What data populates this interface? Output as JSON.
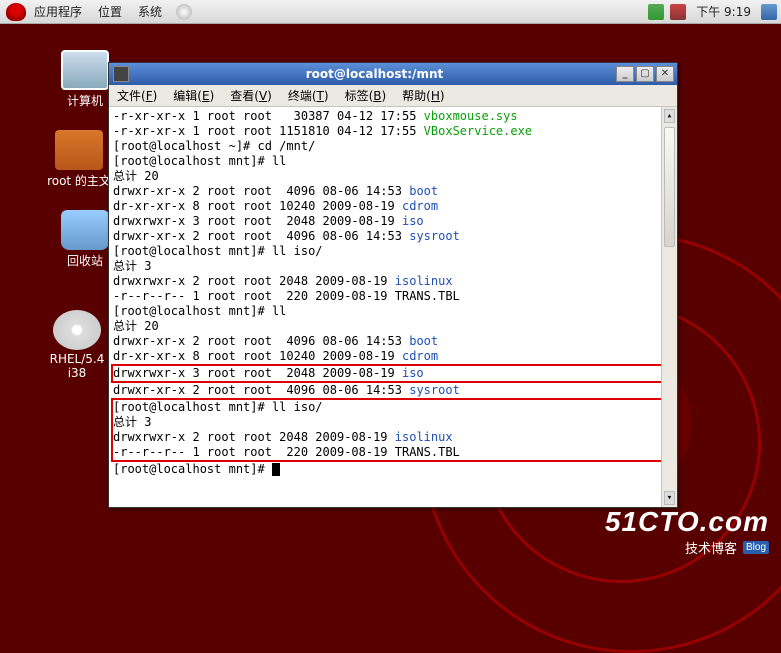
{
  "panel": {
    "menus": [
      "应用程序",
      "位置",
      "系统"
    ],
    "clock": "下午 9:19"
  },
  "desktop": {
    "computer": "计算机",
    "home": "root 的主文",
    "trash": "回收站",
    "disc": "RHEL/5.4 i38"
  },
  "terminal": {
    "title": "root@localhost:/mnt",
    "menubar": [
      {
        "label": "文件",
        "key": "F"
      },
      {
        "label": "编辑",
        "key": "E"
      },
      {
        "label": "查看",
        "key": "V"
      },
      {
        "label": "终端",
        "key": "T"
      },
      {
        "label": "标签",
        "key": "B"
      },
      {
        "label": "帮助",
        "key": "H"
      }
    ],
    "lines": [
      {
        "pre": "-r-xr-xr-x 1 root root   30387 04-12 17:55 ",
        "link": "vboxmouse.sys",
        "cls": "green"
      },
      {
        "pre": "-r-xr-xr-x 1 root root 1151810 04-12 17:55 ",
        "link": "VBoxService.exe",
        "cls": "green"
      },
      {
        "pre": "[root@localhost ~]# cd /mnt/"
      },
      {
        "pre": "[root@localhost mnt]# ll"
      },
      {
        "pre": "总计 20"
      },
      {
        "pre": "drwxr-xr-x 2 root root  4096 08-06 14:53 ",
        "link": "boot",
        "cls": "blue"
      },
      {
        "pre": "dr-xr-xr-x 8 root root 10240 2009-08-19 ",
        "link": "cdrom",
        "cls": "blue"
      },
      {
        "pre": "drwxrwxr-x 3 root root  2048 2009-08-19 ",
        "link": "iso",
        "cls": "blue"
      },
      {
        "pre": "drwxr-xr-x 2 root root  4096 08-06 14:53 ",
        "link": "sysroot",
        "cls": "blue"
      },
      {
        "pre": "[root@localhost mnt]# ll iso/"
      },
      {
        "pre": "总计 3"
      },
      {
        "pre": "drwxrwxr-x 2 root root 2048 2009-08-19 ",
        "link": "isolinux",
        "cls": "blue"
      },
      {
        "pre": "-r--r--r-- 1 root root  220 2009-08-19 TRANS.TBL"
      },
      {
        "pre": "[root@localhost mnt]# ll"
      },
      {
        "pre": "总计 20"
      },
      {
        "pre": "drwxr-xr-x 2 root root  4096 08-06 14:53 ",
        "link": "boot",
        "cls": "blue"
      },
      {
        "pre": "dr-xr-xr-x 8 root root 10240 2009-08-19 ",
        "link": "cdrom",
        "cls": "blue"
      }
    ],
    "boxed1": {
      "pre": "drwxrwxr-x 3 root root  2048 2009-08-19 ",
      "link": "iso",
      "cls": "blue"
    },
    "after_box1": [
      {
        "pre": "drwxr-xr-x 2 root root  4096 08-06 14:53 ",
        "link": "sysroot",
        "cls": "blue"
      }
    ],
    "boxed2_head": {
      "pre": "[root@localhost mnt]# ll iso/"
    },
    "boxed2": [
      {
        "pre": "总计 3"
      },
      {
        "pre": "drwxrwxr-x 2 root root 2048 2009-08-19 ",
        "link": "isolinux",
        "cls": "blue"
      },
      {
        "pre": "-r--r--r-- 1 root root  220 2009-08-19 TRANS.TBL"
      }
    ],
    "prompt": "[root@localhost mnt]# "
  },
  "watermark": {
    "big": "51CTO.com",
    "sub": "技术博客",
    "blog": "Blog"
  }
}
